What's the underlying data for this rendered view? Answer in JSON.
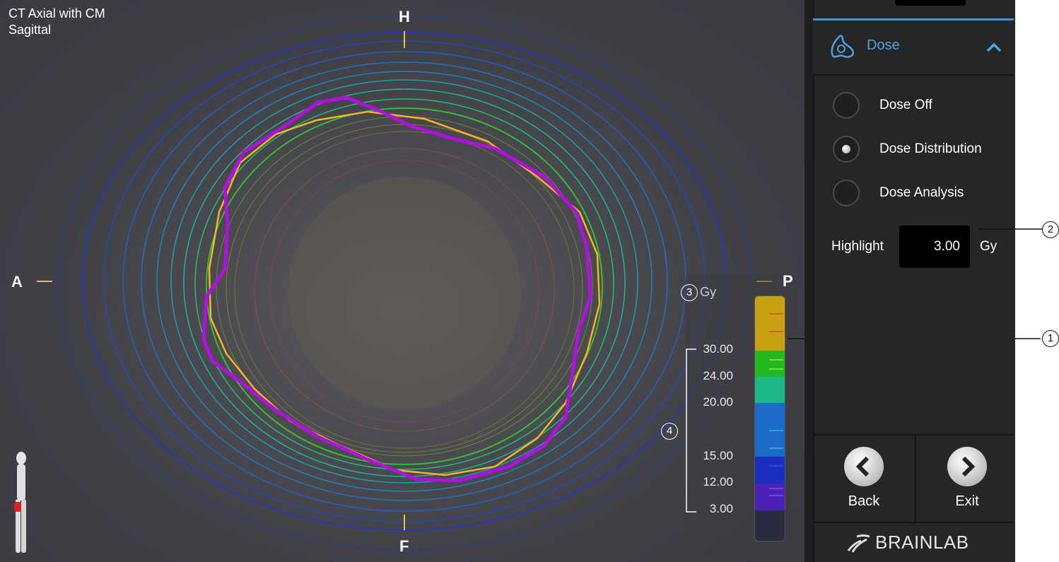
{
  "viewer": {
    "series_line1": "CT Axial with CM",
    "series_line2": "Sagittal",
    "orientation": {
      "top": "H",
      "bottom": "F",
      "left": "A",
      "right": "P"
    },
    "legend": {
      "unit": "Gy",
      "values": [
        "30.00",
        "24.00",
        "20.00",
        "15.00",
        "12.00",
        "3.00"
      ],
      "colors": [
        "#c8a010",
        "#22b820",
        "#1ab888",
        "#1d6bc8",
        "#1a2fc0",
        "#4a22b8"
      ]
    },
    "callouts": {
      "c1": "1",
      "c2": "2",
      "c3": "3",
      "c4": "4"
    }
  },
  "panel": {
    "section_title": "Dose",
    "options": [
      {
        "label": "Dose Off",
        "selected": false
      },
      {
        "label": "Dose Distribution",
        "selected": true
      },
      {
        "label": "Dose Analysis",
        "selected": false
      }
    ],
    "highlight": {
      "label": "Highlight",
      "value": "3.00",
      "unit": "Gy"
    },
    "back_label": "Back",
    "exit_label": "Exit",
    "brand": "BRAINLAB"
  },
  "colors": {
    "accent": "#3a9ad9",
    "target_contour": "#b010e0",
    "highlight_line": "#f0b020"
  }
}
